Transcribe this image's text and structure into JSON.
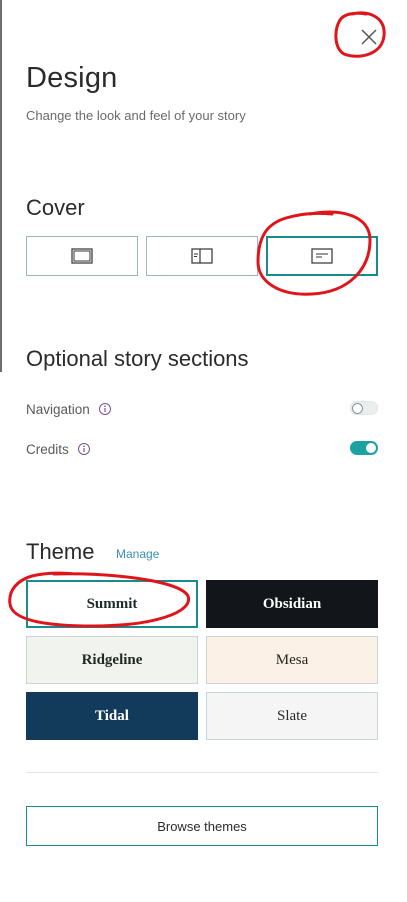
{
  "header": {
    "title": "Design",
    "subtitle": "Change the look and feel of your story"
  },
  "close": {
    "icon": "close-icon"
  },
  "cover": {
    "title": "Cover",
    "options": [
      {
        "icon": "cover-full-icon",
        "selected": false
      },
      {
        "icon": "cover-split-icon",
        "selected": false
      },
      {
        "icon": "cover-minimal-icon",
        "selected": true
      }
    ]
  },
  "sections": {
    "title": "Optional story sections",
    "items": [
      {
        "label": "Navigation",
        "info_icon": "info-icon",
        "enabled": false
      },
      {
        "label": "Credits",
        "info_icon": "info-icon",
        "enabled": true
      }
    ]
  },
  "theme": {
    "title": "Theme",
    "manage_label": "Manage",
    "cards": [
      {
        "label": "Summit",
        "bg": "#ffffff",
        "fg": "#1d2b2a",
        "selected": true
      },
      {
        "label": "Obsidian",
        "bg": "#121519",
        "fg": "#ffffff",
        "selected": false
      },
      {
        "label": "Ridgeline",
        "bg": "#f1f4ee",
        "fg": "#1f2a22",
        "selected": false
      },
      {
        "label": "Mesa",
        "bg": "#fbf1e6",
        "fg": "#2a2420",
        "selected": false
      },
      {
        "label": "Tidal",
        "bg": "#123b5b",
        "fg": "#ffffff",
        "selected": false
      },
      {
        "label": "Slate",
        "bg": "#f5f5f5",
        "fg": "#2b2b2b",
        "selected": false
      }
    ]
  },
  "footer": {
    "browse_label": "Browse themes"
  },
  "colors": {
    "accent": "#1a8b8a",
    "annotation": "#e0151b"
  }
}
